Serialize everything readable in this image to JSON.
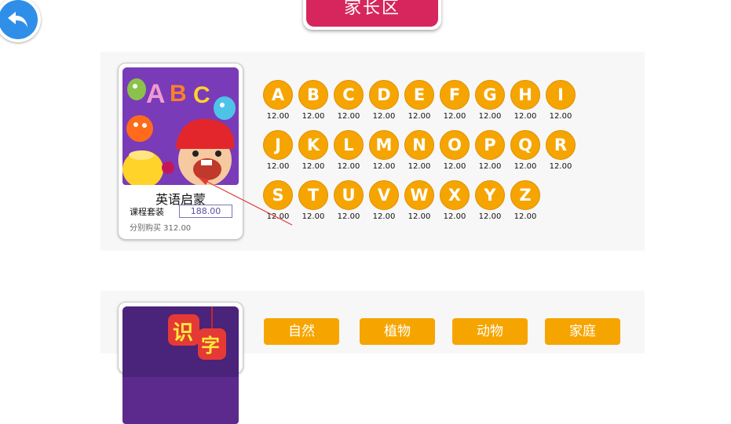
{
  "header": {
    "title": "家长区"
  },
  "english": {
    "card_title": "英语启蒙",
    "bundle_label": "课程套装",
    "bundle_price": "188.00",
    "separate_text": "分别购买 312.00",
    "cover_letters": "ABC",
    "letters": [
      {
        "letter": "A",
        "price": "12.00"
      },
      {
        "letter": "B",
        "price": "12.00"
      },
      {
        "letter": "C",
        "price": "12.00"
      },
      {
        "letter": "D",
        "price": "12.00"
      },
      {
        "letter": "E",
        "price": "12.00"
      },
      {
        "letter": "F",
        "price": "12.00"
      },
      {
        "letter": "G",
        "price": "12.00"
      },
      {
        "letter": "H",
        "price": "12.00"
      },
      {
        "letter": "I",
        "price": "12.00"
      },
      {
        "letter": "J",
        "price": "12.00"
      },
      {
        "letter": "K",
        "price": "12.00"
      },
      {
        "letter": "L",
        "price": "12.00"
      },
      {
        "letter": "M",
        "price": "12.00"
      },
      {
        "letter": "N",
        "price": "12.00"
      },
      {
        "letter": "O",
        "price": "12.00"
      },
      {
        "letter": "P",
        "price": "12.00"
      },
      {
        "letter": "Q",
        "price": "12.00"
      },
      {
        "letter": "R",
        "price": "12.00"
      },
      {
        "letter": "S",
        "price": "12.00"
      },
      {
        "letter": "T",
        "price": "12.00"
      },
      {
        "letter": "U",
        "price": "12.00"
      },
      {
        "letter": "V",
        "price": "12.00"
      },
      {
        "letter": "W",
        "price": "12.00"
      },
      {
        "letter": "X",
        "price": "12.00"
      },
      {
        "letter": "Y",
        "price": "12.00"
      },
      {
        "letter": "Z",
        "price": "12.00"
      }
    ]
  },
  "chinese": {
    "cover_text": "识字",
    "categories": [
      "自然",
      "植物",
      "动物",
      "家庭"
    ]
  },
  "colors": {
    "accent": "#f6a500",
    "title_bg": "#d6265d",
    "back_bg": "#2f8fe8",
    "cover_bg": "#7a3bb8"
  },
  "icons": {
    "back": "back-arrow-icon"
  }
}
